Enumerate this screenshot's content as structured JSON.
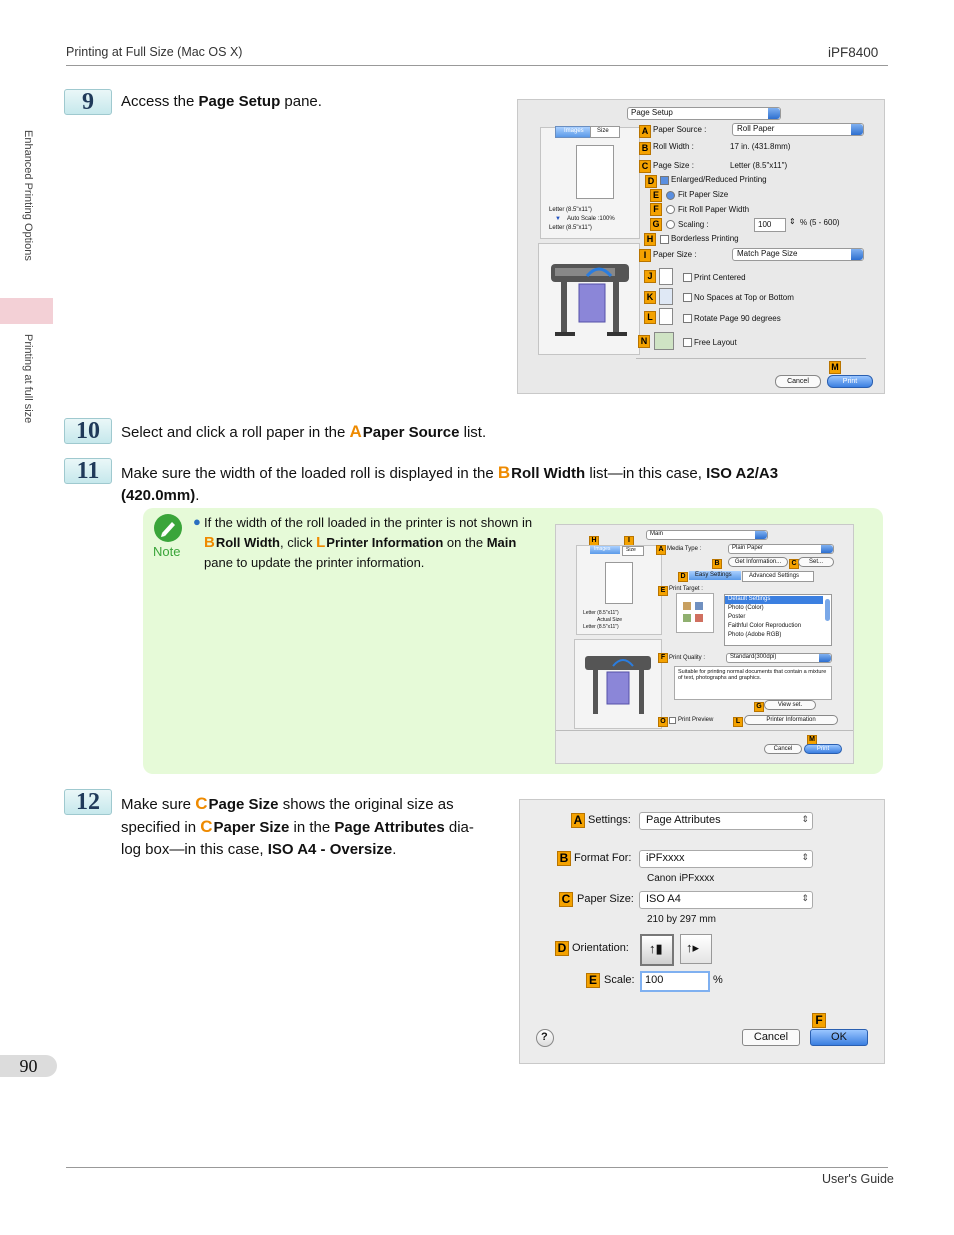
{
  "header": {
    "left": "Printing at Full Size (Mac OS X)",
    "right": "iPF8400"
  },
  "footer": {
    "right": "User's Guide",
    "page_number": "90"
  },
  "side": {
    "section1": "Enhanced Printing Options",
    "section2": "Printing at full size"
  },
  "steps": {
    "s9": {
      "num": "9",
      "pre": "Access the ",
      "bold": "Page Setup",
      "post": " pane."
    },
    "s10": {
      "num": "10",
      "pre": "Select and click a roll paper in the ",
      "letter": "A",
      "bold": "Paper Source",
      "post": " list."
    },
    "s11": {
      "num": "11",
      "pre": "Make sure the width of the loaded roll is displayed in the ",
      "letter": "B",
      "bold": "Roll Width",
      "mid": " list—in this case, ",
      "bold2": "ISO A2/A3",
      "bold3": "(420.0mm)",
      "post": "."
    },
    "s12": {
      "num": "12",
      "l1_pre": "Make sure ",
      "letter1": "C",
      "bold1": "Page Size",
      "l1_post": " shows the original size as",
      "l2_pre": "specified in ",
      "letter2": "C",
      "bold2": "Paper Size",
      "l2_mid": " in the ",
      "bold3": "Page Attributes",
      "l2_post": " dia-",
      "l3_pre": "log box—in this case, ",
      "bold4": "ISO A4 - Oversize",
      "l3_post": "."
    }
  },
  "note": {
    "label": "Note",
    "l1": "If the width of the roll loaded in the printer is not shown in",
    "letterB": "B",
    "roll_width": "Roll Width",
    "click": ", click ",
    "letterL": "L",
    "printer_info": "Printer Information",
    "on_the": " on the ",
    "main": "Main",
    "l3": "pane to update the printer information."
  },
  "shot1": {
    "pane": "Page Setup",
    "tabs": [
      "Images",
      "Size"
    ],
    "paper_info": [
      "Letter (8.5\"x11\")",
      "Auto Scale :100%",
      "Letter (8.5\"x11\")"
    ],
    "paper_source_label": "Paper Source :",
    "paper_source_value": "Roll Paper",
    "roll_width_label": "Roll Width :",
    "roll_width_value": "17 in. (431.8mm)",
    "page_size_label": "Page Size :",
    "page_size_value": "Letter (8.5\"x11\")",
    "enlarged": "Enlarged/Reduced Printing",
    "fit_paper": "Fit Paper Size",
    "fit_roll": "Fit Roll Paper Width",
    "scaling": "Scaling :",
    "scaling_value": "100",
    "scaling_range": "% (5 - 600)",
    "borderless": "Borderless Printing",
    "paper_size_label": "Paper Size :",
    "paper_size_value": "Match Page Size",
    "print_centered": "Print Centered",
    "no_spaces": "No Spaces at Top or Bottom",
    "rotate": "Rotate Page 90 degrees",
    "free_layout": "Free Layout",
    "cancel": "Cancel",
    "print": "Print",
    "badges": [
      "A",
      "B",
      "C",
      "D",
      "E",
      "F",
      "G",
      "H",
      "I",
      "J",
      "K",
      "L",
      "N",
      "M"
    ]
  },
  "shot2": {
    "pane": "Main",
    "tabs": [
      "Images",
      "Size"
    ],
    "paper_info": [
      "Letter (8.5\"x11\")",
      "Actual Size",
      "Letter (8.5\"x11\")"
    ],
    "media_type_label": "Media Type :",
    "media_type_value": "Plain Paper",
    "get_info": "Get Information...",
    "set": "Set...",
    "easy": "Easy Settings",
    "advanced": "Advanced Settings",
    "print_target": "Print Target :",
    "targets": [
      "Default Settings",
      "Photo (Color)",
      "Poster",
      "Faithful Color Reproduction",
      "Photo (Adobe RGB)"
    ],
    "print_quality_label": "Print Quality :",
    "print_quality_value": "Standard(300dpi)",
    "desc": "Suitable for printing normal documents that contain a mixture of text, photographs and graphics.",
    "view_set": "View set.",
    "print_preview": "Print Preview",
    "printer_information": "Printer Information",
    "cancel": "Cancel",
    "print": "Print",
    "badges": [
      "H",
      "I",
      "A",
      "B",
      "C",
      "D",
      "E",
      "F",
      "G",
      "O",
      "L",
      "M"
    ]
  },
  "shot3": {
    "settings_label": "Settings:",
    "settings_value": "Page Attributes",
    "format_label": "Format For:",
    "format_value": "iPFxxxx",
    "format_sub": "Canon iPFxxxx",
    "paper_label": "Paper Size:",
    "paper_value": "ISO A4",
    "paper_sub": "210 by 297 mm",
    "orient_label": "Orientation:",
    "scale_label": "Scale:",
    "scale_value": "100",
    "scale_unit": "%",
    "cancel": "Cancel",
    "ok": "OK",
    "help": "?",
    "badges": [
      "A",
      "B",
      "C",
      "D",
      "E",
      "F"
    ]
  },
  "colors": {
    "letter": "#ee8a00",
    "note_bg": "#e6fad8",
    "badge": "#f4a200"
  }
}
